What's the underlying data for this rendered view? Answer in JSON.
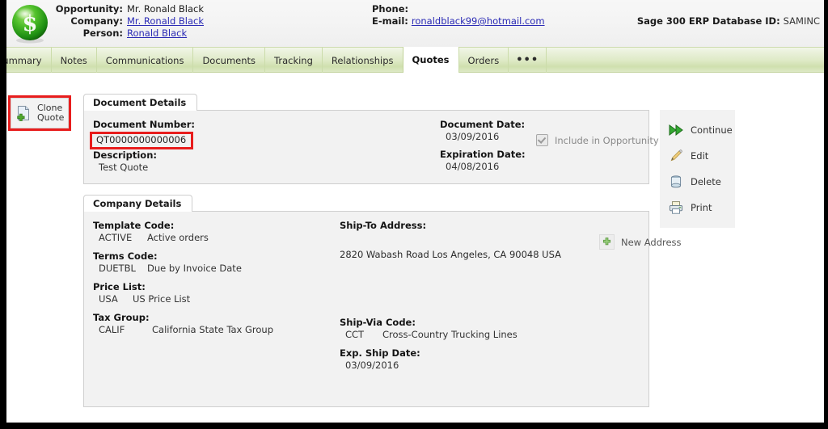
{
  "header": {
    "logo_icon": "green-dollar-sphere-icon",
    "left_rows": [
      {
        "label": "Opportunity:",
        "value": "Mr. Ronald Black",
        "link": false
      },
      {
        "label": "Company:",
        "value": "Mr. Ronald Black",
        "link": true
      },
      {
        "label": "Person:",
        "value": "Ronald Black",
        "link": true
      }
    ],
    "mid_rows": [
      {
        "label": "Phone:",
        "value": "",
        "link": false
      },
      {
        "label": "E-mail:",
        "value": "ronaldblack99@hotmail.com",
        "link": true
      }
    ],
    "database": {
      "label": "Sage 300 ERP Database ID:",
      "value": "SAMINC"
    }
  },
  "tabs": [
    {
      "label": "Summary",
      "active": false
    },
    {
      "label": "Notes",
      "active": false
    },
    {
      "label": "Communications",
      "active": false
    },
    {
      "label": "Documents",
      "active": false
    },
    {
      "label": "Tracking",
      "active": false
    },
    {
      "label": "Relationships",
      "active": false
    },
    {
      "label": "Quotes",
      "active": true
    },
    {
      "label": "Orders",
      "active": false
    }
  ],
  "more_tab": {
    "label": "•••",
    "name": "more-tabs-button"
  },
  "toolbar": {
    "clone_quote": {
      "line1": "Clone",
      "line2": "Quote",
      "icon": "document-add-icon"
    }
  },
  "document_details": {
    "tab_label": "Document Details",
    "document_number_label": "Document Number:",
    "document_number_value": "QT0000000000006",
    "description_label": "Description:",
    "description_value": "Test Quote",
    "document_date_label": "Document Date:",
    "document_date_value": "03/09/2016",
    "expiration_date_label": "Expiration Date:",
    "expiration_date_value": "04/08/2016",
    "include_total_label": "Include in Opportunity Total",
    "include_total_checked": true
  },
  "company_details": {
    "tab_label": "Company Details",
    "template_code_label": "Template Code:",
    "template_code": "ACTIVE",
    "template_desc": "Active orders",
    "terms_code_label": "Terms Code:",
    "terms_code": "DUETBL",
    "terms_desc": "Due by Invoice Date",
    "price_list_label": "Price List:",
    "price_list_code": "USA",
    "price_list_desc": "US Price List",
    "tax_group_label": "Tax Group:",
    "tax_group_code": "CALIF",
    "tax_group_desc": "California State Tax Group",
    "ship_to_label": "Ship-To Address:",
    "ship_to_value": "2820 Wabash Road Los Angeles, CA 90048 USA",
    "new_address_label": "New Address",
    "new_address_icon": "plus-square-icon",
    "ship_via_label": "Ship-Via Code:",
    "ship_via_code": "CCT",
    "ship_via_desc": "Cross-Country Trucking Lines",
    "exp_ship_label": "Exp. Ship Date:",
    "exp_ship_value": "03/09/2016"
  },
  "actions": [
    {
      "label": "Continue",
      "icon": "fast-forward-icon"
    },
    {
      "label": "Edit",
      "icon": "pencil-icon"
    },
    {
      "label": "Delete",
      "icon": "trash-can-icon"
    },
    {
      "label": "Print",
      "icon": "printer-icon"
    }
  ],
  "colors": {
    "highlight": "#e81d1d",
    "tab_green": "#cfe0ae",
    "panel_bg": "#f2f2f2",
    "link": "#2a2ab5"
  }
}
